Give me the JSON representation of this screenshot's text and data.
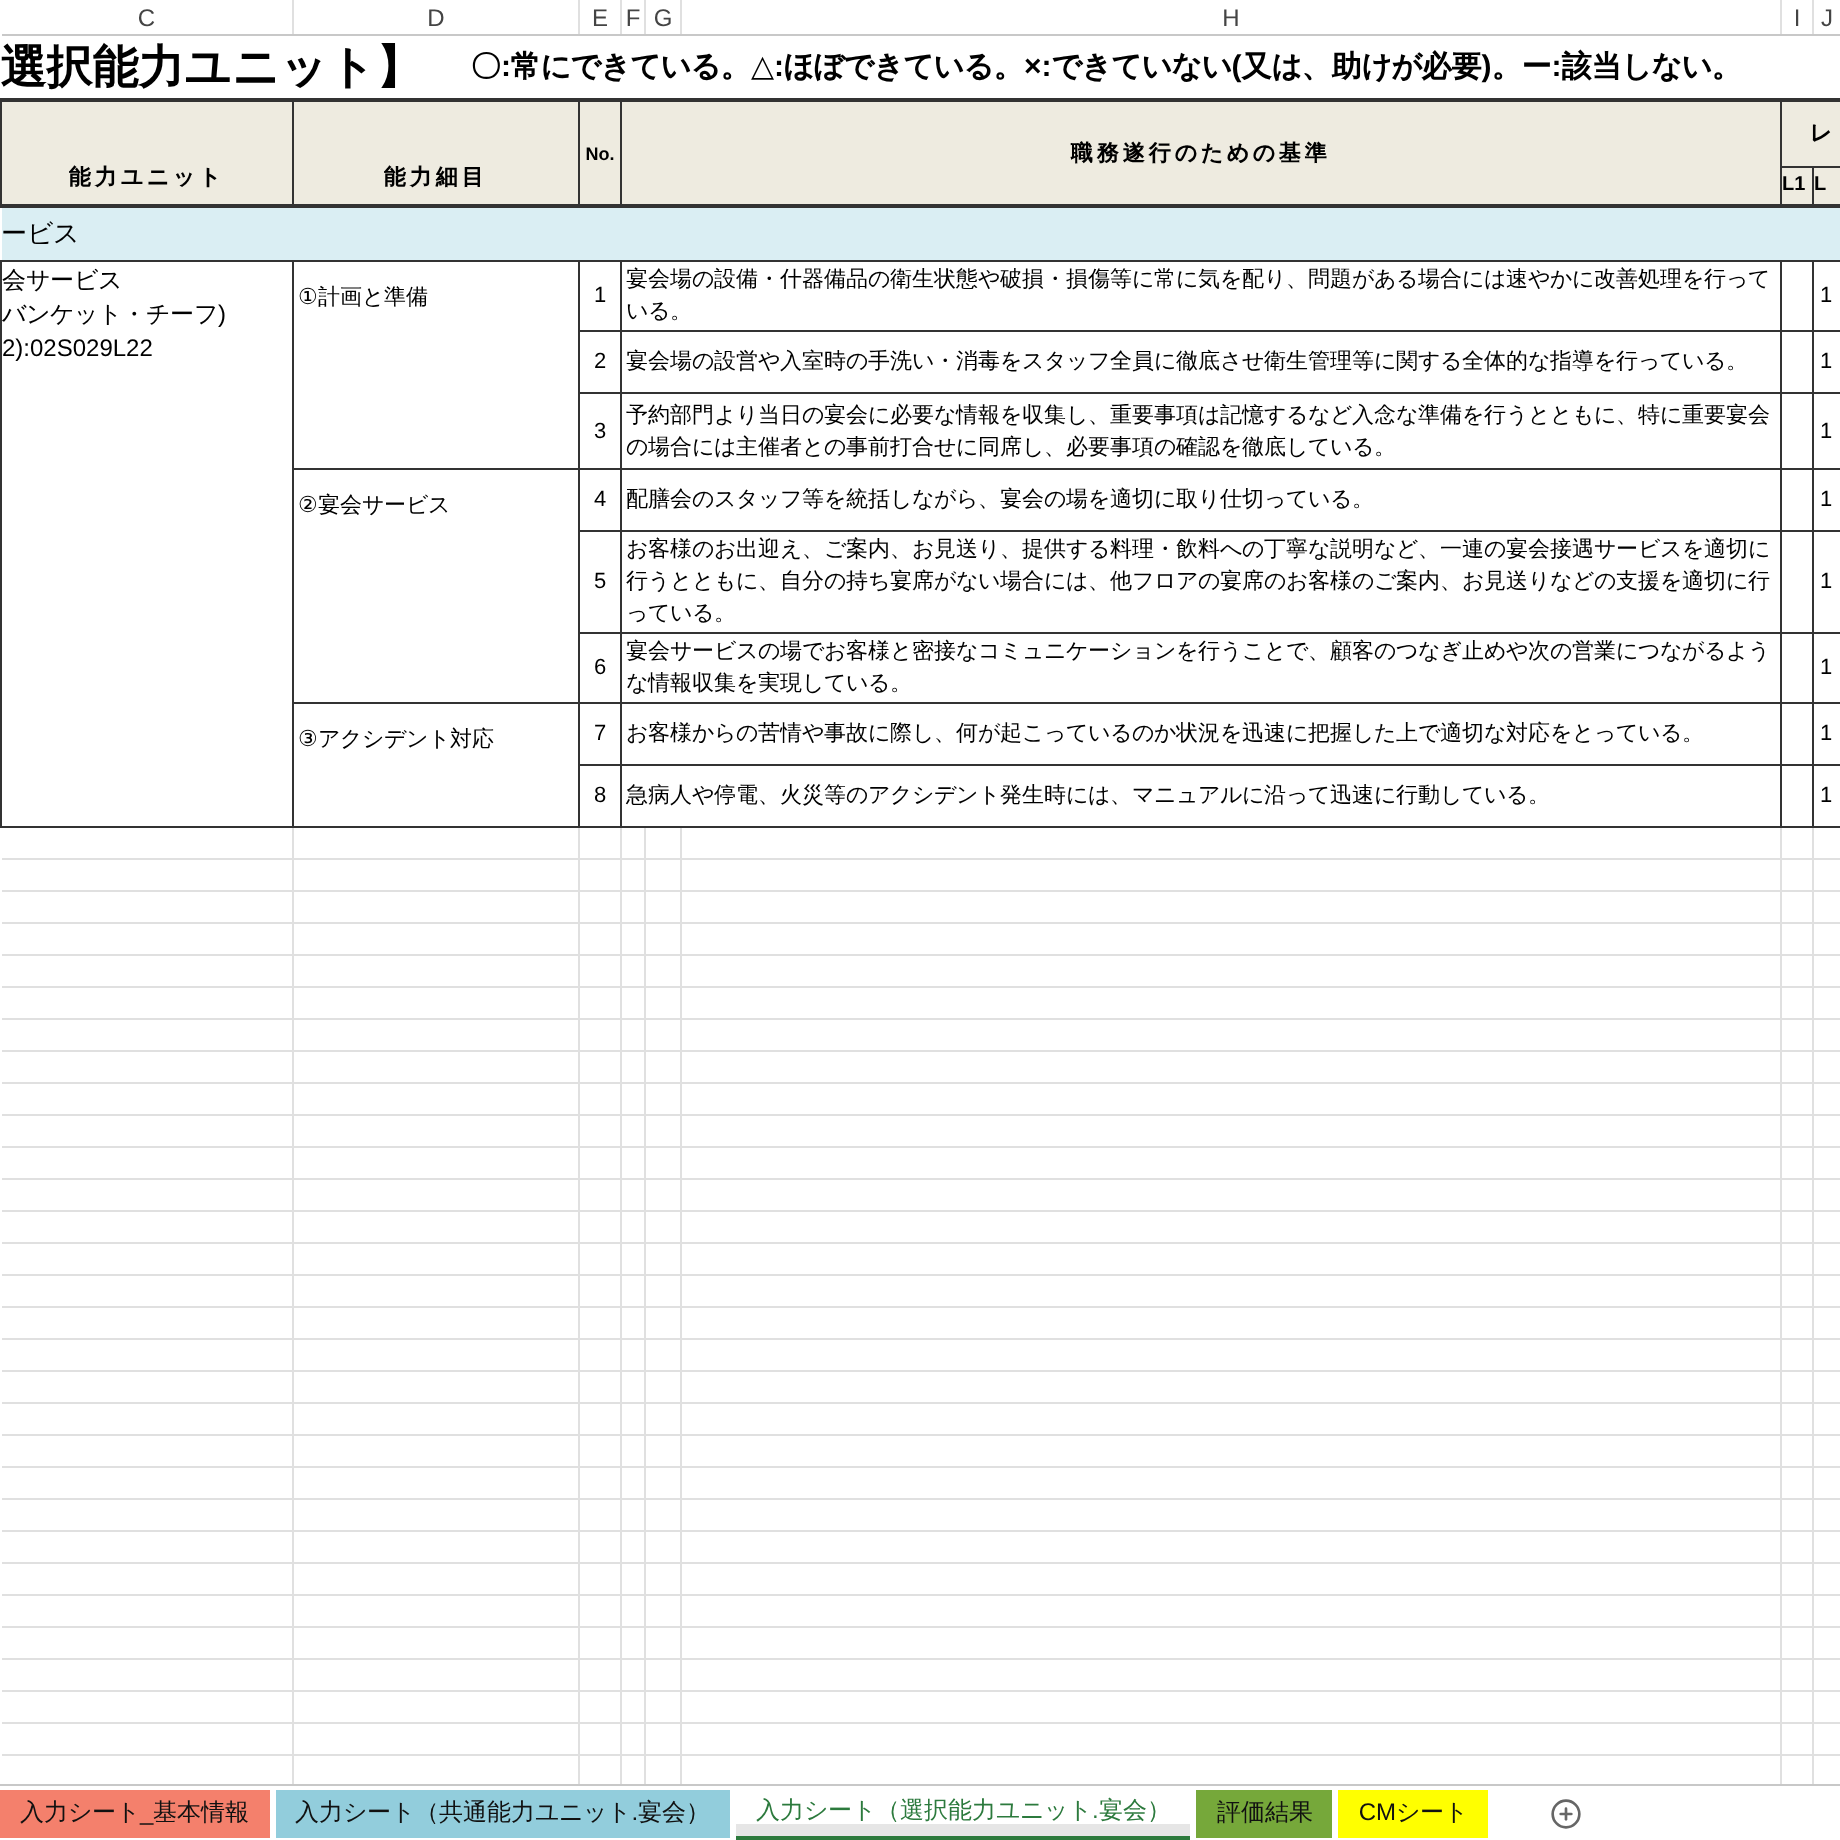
{
  "column_headers": [
    "C",
    "D",
    "E",
    "F",
    "G",
    "H",
    "I",
    "J"
  ],
  "title": "選択能力ユニット】",
  "legend": "〇:常にできている。△:ほぼできている。×:できていない(又は、助けが必要)。ー:該当しない。",
  "table_header": {
    "unit": "能力ユニット",
    "detail": "能力細目",
    "no": "No.",
    "criteria": "職務遂行のための基準",
    "level": "レ",
    "levels": [
      "L1",
      "L"
    ]
  },
  "section": "ービス",
  "unit_lines": [
    "会サービス",
    "バンケット・チーフ)",
    "2):02S029L22"
  ],
  "groups": [
    {
      "detail": "①計画と準備",
      "items": [
        {
          "no": "1",
          "text": "宴会場の設備・什器備品の衛生状態や破損・損傷等に常に気を配り、問題がある場合には速やかに改善処理を行っている。",
          "level_value": "1"
        },
        {
          "no": "2",
          "text": "宴会場の設営や入室時の手洗い・消毒をスタッフ全員に徹底させ衛生管理等に関する全体的な指導を行っている。",
          "level_value": "1"
        },
        {
          "no": "3",
          "text": "予約部門より当日の宴会に必要な情報を収集し、重要事項は記憶するなど入念な準備を行うとともに、特に重要宴会の場合には主催者との事前打合せに同席し、必要事項の確認を徹底している。",
          "level_value": "1"
        }
      ]
    },
    {
      "detail": "②宴会サービス",
      "items": [
        {
          "no": "4",
          "text": "配膳会のスタッフ等を統括しながら、宴会の場を適切に取り仕切っている。",
          "level_value": "1"
        },
        {
          "no": "5",
          "text": "お客様のお出迎え、ご案内、お見送り、提供する料理・飲料への丁寧な説明など、一連の宴会接遇サービスを適切に行うとともに、自分の持ち宴席がない場合には、他フロアの宴席のお客様のご案内、お見送りなどの支援を適切に行っている。",
          "level_value": "1"
        },
        {
          "no": "6",
          "text": "宴会サービスの場でお客様と密接なコミュニケーションを行うことで、顧客のつなぎ止めや次の営業につながるような情報収集を実現している。",
          "level_value": "1"
        }
      ]
    },
    {
      "detail": "③アクシデント対応",
      "items": [
        {
          "no": "7",
          "text": "お客様からの苦情や事故に際し、何が起こっているのか状況を迅速に把握した上で適切な対応をとっている。",
          "level_value": "1"
        },
        {
          "no": "8",
          "text": "急病人や停電、火災等のアクシデント発生時には、マニュアルに沿って迅速に行動している。",
          "level_value": "1"
        }
      ]
    }
  ],
  "sheet_tabs": [
    {
      "label": "入力シート_基本情報",
      "color": "#f4806c",
      "selected": false
    },
    {
      "label": "入力シート（共通能力ユニット.宴会）",
      "color": "#92cddc",
      "selected": false
    },
    {
      "label": "入力シート（選択能力ユニット.宴会）",
      "color": "#e6e6e6",
      "selected": true
    },
    {
      "label": "評価結果",
      "color": "#76a83a",
      "selected": false
    },
    {
      "label": "CMシート",
      "color": "#ffff00",
      "selected": false
    }
  ]
}
